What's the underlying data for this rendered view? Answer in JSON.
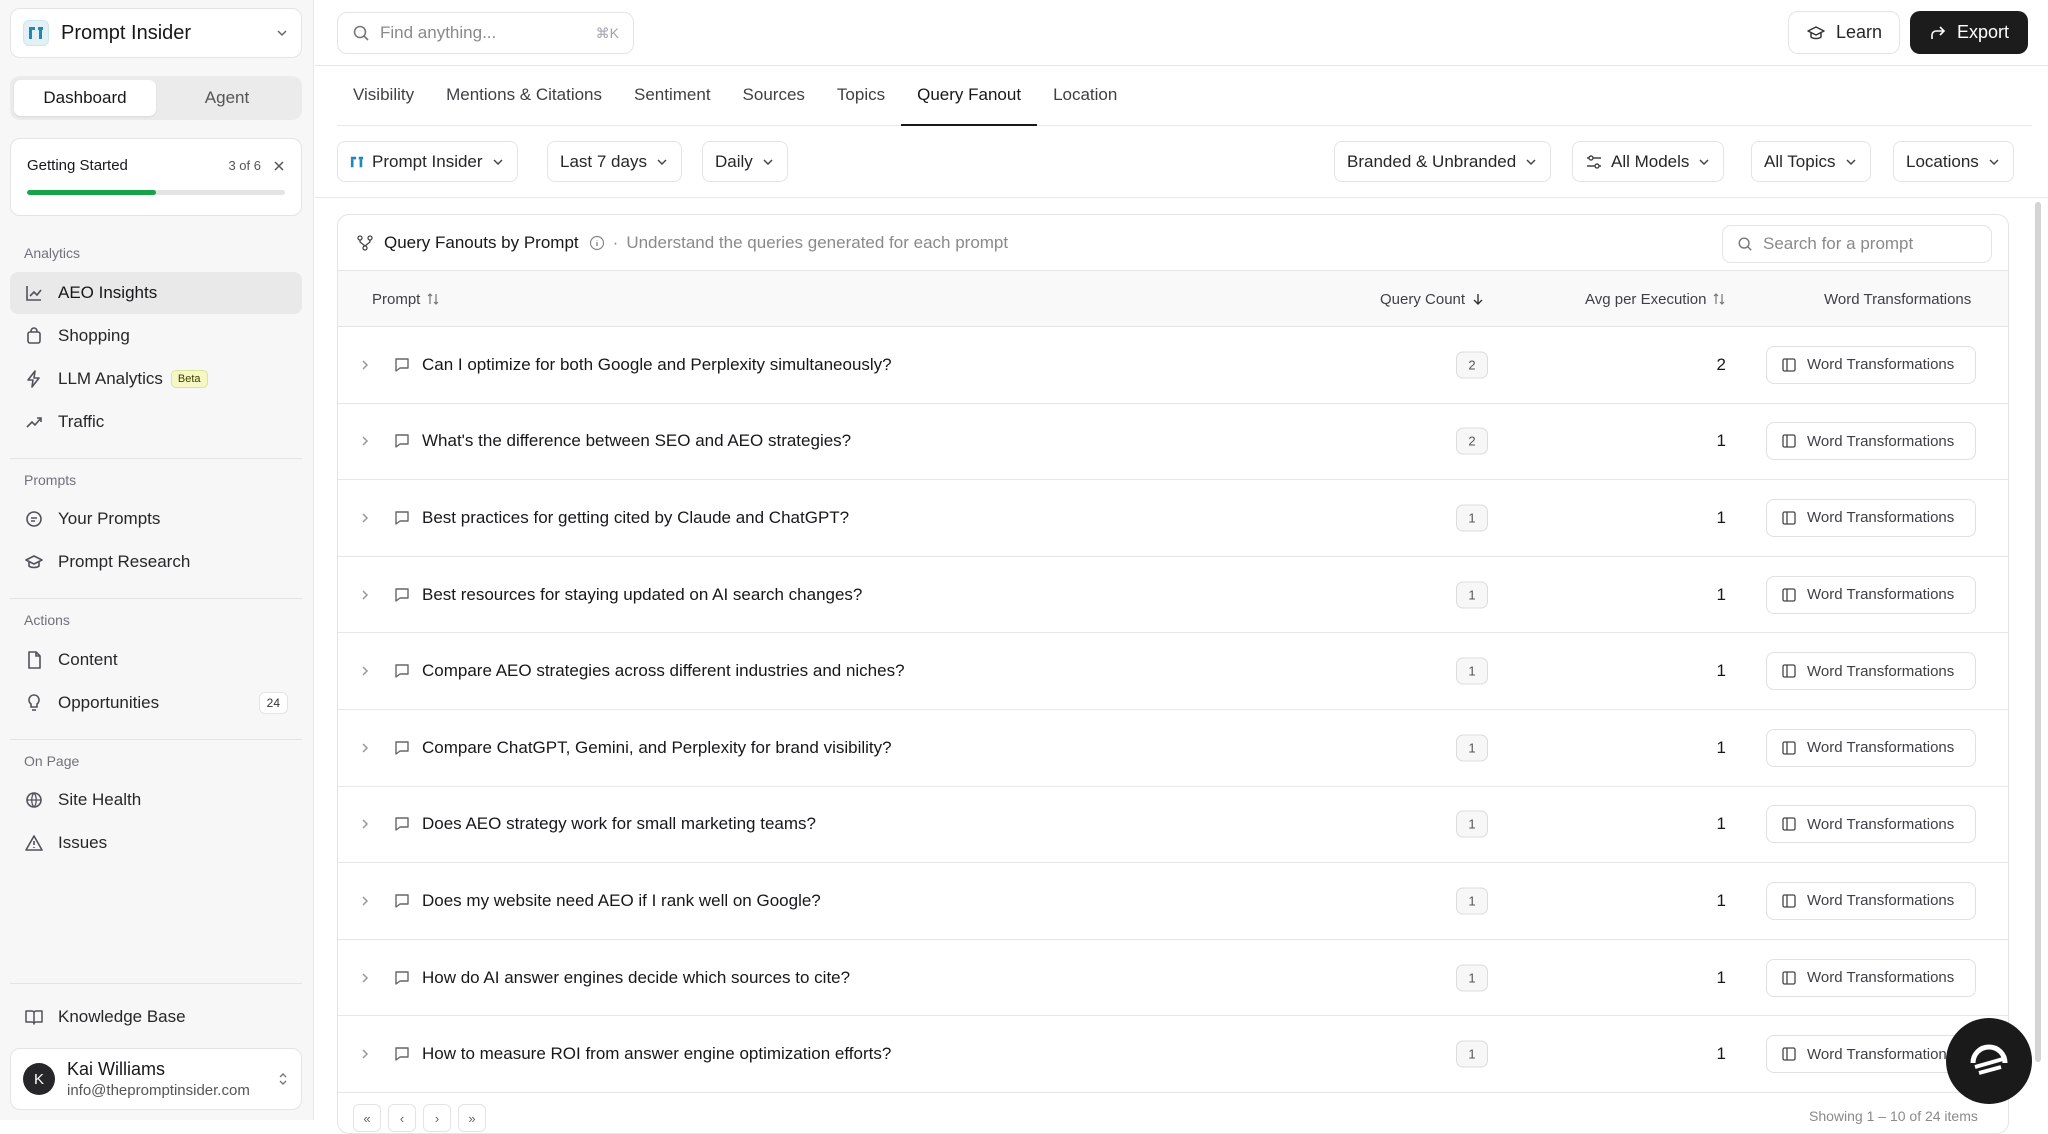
{
  "workspace": {
    "name": "Prompt Insider"
  },
  "mode_tabs": {
    "dashboard": "Dashboard",
    "agent": "Agent"
  },
  "getting_started": {
    "title": "Getting Started",
    "count": "3 of 6",
    "progress": 0.5
  },
  "sidebar": {
    "analytics_label": "Analytics",
    "analytics": [
      {
        "label": "AEO Insights",
        "icon": "chart-line-icon"
      },
      {
        "label": "Shopping",
        "icon": "shopping-bag-icon"
      },
      {
        "label": "LLM Analytics",
        "icon": "bolt-icon",
        "badge": "Beta"
      },
      {
        "label": "Traffic",
        "icon": "trend-icon"
      }
    ],
    "prompts_label": "Prompts",
    "prompts": [
      {
        "label": "Your Prompts",
        "icon": "chat-icon"
      },
      {
        "label": "Prompt Research",
        "icon": "graduation-cap-icon"
      }
    ],
    "actions_label": "Actions",
    "actions": [
      {
        "label": "Content",
        "icon": "file-icon"
      },
      {
        "label": "Opportunities",
        "icon": "lightbulb-icon",
        "badge": "24"
      }
    ],
    "onpage_label": "On Page",
    "onpage": [
      {
        "label": "Site Health",
        "icon": "globe-icon"
      },
      {
        "label": "Issues",
        "icon": "warning-icon"
      }
    ],
    "knowledge_base": "Knowledge Base"
  },
  "user": {
    "initial": "K",
    "name": "Kai Williams",
    "email": "info@thepromptinsider.com"
  },
  "topbar": {
    "search_placeholder": "Find anything...",
    "shortcut": "⌘K",
    "learn": "Learn",
    "export": "Export"
  },
  "tabs": [
    "Visibility",
    "Mentions & Citations",
    "Sentiment",
    "Sources",
    "Topics",
    "Query Fanout",
    "Location"
  ],
  "active_tab": "Query Fanout",
  "filters": {
    "brand": "Prompt Insider",
    "range": "Last 7 days",
    "interval": "Daily",
    "branded": "Branded & Unbranded",
    "models": "All Models",
    "topics": "All Topics",
    "locations": "Locations"
  },
  "card": {
    "title": "Query Fanouts by Prompt",
    "subtitle": "Understand the queries generated for each prompt",
    "search_placeholder": "Search for a prompt"
  },
  "columns": {
    "prompt": "Prompt",
    "query_count": "Query Count",
    "avg": "Avg per Execution",
    "word": "Word Transformations"
  },
  "rows": [
    {
      "prompt": "Can I optimize for both Google and Perplexity simultaneously?",
      "count": "2",
      "avg": "2"
    },
    {
      "prompt": "What's the difference between SEO and AEO strategies?",
      "count": "2",
      "avg": "1"
    },
    {
      "prompt": "Best practices for getting cited by Claude and ChatGPT?",
      "count": "1",
      "avg": "1"
    },
    {
      "prompt": "Best resources for staying updated on AI search changes?",
      "count": "1",
      "avg": "1"
    },
    {
      "prompt": "Compare AEO strategies across different industries and niches?",
      "count": "1",
      "avg": "1"
    },
    {
      "prompt": "Compare ChatGPT, Gemini, and Perplexity for brand visibility?",
      "count": "1",
      "avg": "1"
    },
    {
      "prompt": "Does AEO strategy work for small marketing teams?",
      "count": "1",
      "avg": "1"
    },
    {
      "prompt": "Does my website need AEO if I rank well on Google?",
      "count": "1",
      "avg": "1"
    },
    {
      "prompt": "How do AI answer engines decide which sources to cite?",
      "count": "1",
      "avg": "1"
    },
    {
      "prompt": "How to measure ROI from answer engine optimization efforts?",
      "count": "1",
      "avg": "1"
    }
  ],
  "row_button": "Word Transformations",
  "footer": {
    "showing": "Showing 1 – 10 of 24 items"
  }
}
